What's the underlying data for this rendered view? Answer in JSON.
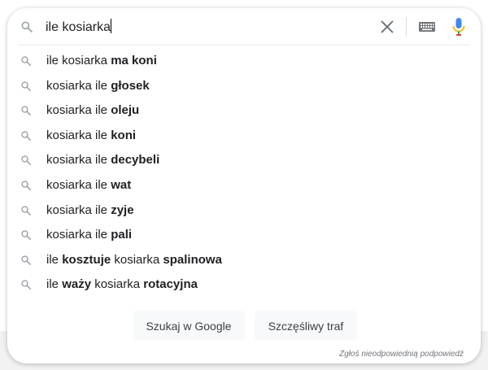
{
  "search": {
    "query": "ile kosiarka",
    "clear_icon": "close-icon",
    "keyboard_icon": "keyboard-icon",
    "mic_icon": "microphone-icon"
  },
  "suggestions": [
    {
      "parts": [
        {
          "t": "ile kosiarka ",
          "b": false
        },
        {
          "t": "ma koni",
          "b": true
        }
      ]
    },
    {
      "parts": [
        {
          "t": "kosiarka ile ",
          "b": false
        },
        {
          "t": "głosek",
          "b": true
        }
      ]
    },
    {
      "parts": [
        {
          "t": "kosiarka ile ",
          "b": false
        },
        {
          "t": "oleju",
          "b": true
        }
      ]
    },
    {
      "parts": [
        {
          "t": "kosiarka ile ",
          "b": false
        },
        {
          "t": "koni",
          "b": true
        }
      ]
    },
    {
      "parts": [
        {
          "t": "kosiarka ile ",
          "b": false
        },
        {
          "t": "decybeli",
          "b": true
        }
      ]
    },
    {
      "parts": [
        {
          "t": "kosiarka ile ",
          "b": false
        },
        {
          "t": "wat",
          "b": true
        }
      ]
    },
    {
      "parts": [
        {
          "t": "kosiarka ile ",
          "b": false
        },
        {
          "t": "zyje",
          "b": true
        }
      ]
    },
    {
      "parts": [
        {
          "t": "kosiarka ile ",
          "b": false
        },
        {
          "t": "pali",
          "b": true
        }
      ]
    },
    {
      "parts": [
        {
          "t": "ile ",
          "b": false
        },
        {
          "t": "kosztuje",
          "b": true
        },
        {
          "t": " kosiarka ",
          "b": false
        },
        {
          "t": "spalinowa",
          "b": true
        }
      ]
    },
    {
      "parts": [
        {
          "t": "ile ",
          "b": false
        },
        {
          "t": "waży",
          "b": true
        },
        {
          "t": " kosiarka ",
          "b": false
        },
        {
          "t": "rotacyjna",
          "b": true
        }
      ]
    }
  ],
  "buttons": {
    "search_label": "Szukaj w Google",
    "lucky_label": "Szczęśliwy traf"
  },
  "report_link": "Zgłoś nieodpowiednią podpowiedź",
  "colors": {
    "mic_blue": "#4285f4",
    "mic_red": "#ea4335",
    "mic_yellow": "#fbbc04",
    "mic_green": "#34a853"
  }
}
